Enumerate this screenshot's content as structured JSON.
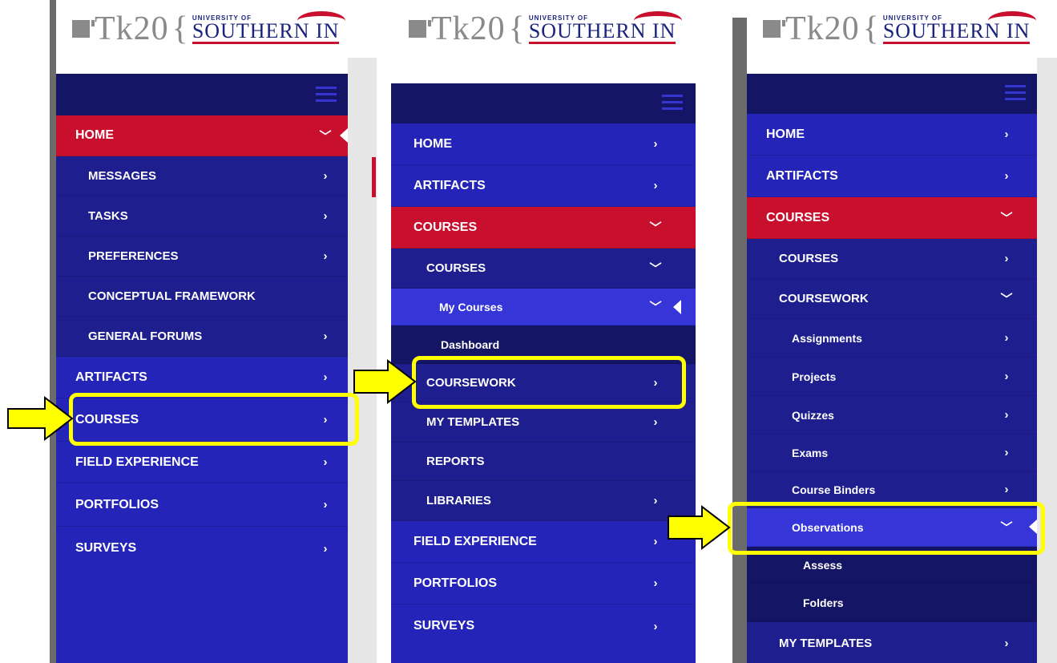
{
  "logo": {
    "tk": "Tk20",
    "brace": "{",
    "university_small": "UNIVERSITY OF",
    "university_big": "SOUTHERN IN"
  },
  "panel1": {
    "items": [
      {
        "label": "HOME",
        "chevron": "﹀"
      },
      {
        "label": "MESSAGES",
        "chevron": "›"
      },
      {
        "label": "TASKS",
        "chevron": "›"
      },
      {
        "label": "PREFERENCES",
        "chevron": "›"
      },
      {
        "label": "CONCEPTUAL FRAMEWORK",
        "chevron": ""
      },
      {
        "label": "GENERAL FORUMS",
        "chevron": "›"
      },
      {
        "label": "ARTIFACTS",
        "chevron": "›"
      },
      {
        "label": "COURSES",
        "chevron": "›"
      },
      {
        "label": "FIELD EXPERIENCE",
        "chevron": "›"
      },
      {
        "label": "PORTFOLIOS",
        "chevron": "›"
      },
      {
        "label": "SURVEYS",
        "chevron": "›"
      }
    ]
  },
  "panel2": {
    "items": [
      {
        "label": "HOME",
        "chevron": "›"
      },
      {
        "label": "ARTIFACTS",
        "chevron": "›"
      },
      {
        "label": "COURSES",
        "chevron": "﹀"
      },
      {
        "label": "COURSES",
        "chevron": "﹀"
      },
      {
        "label": "My Courses",
        "chevron": "﹀"
      },
      {
        "label": "Dashboard",
        "chevron": ""
      },
      {
        "label": "COURSEWORK",
        "chevron": "›"
      },
      {
        "label": "MY TEMPLATES",
        "chevron": "›"
      },
      {
        "label": "REPORTS",
        "chevron": ""
      },
      {
        "label": "LIBRARIES",
        "chevron": "›"
      },
      {
        "label": "FIELD EXPERIENCE",
        "chevron": "›"
      },
      {
        "label": "PORTFOLIOS",
        "chevron": "›"
      },
      {
        "label": "SURVEYS",
        "chevron": "›"
      }
    ]
  },
  "panel3": {
    "items": [
      {
        "label": "HOME",
        "chevron": "›"
      },
      {
        "label": "ARTIFACTS",
        "chevron": "›"
      },
      {
        "label": "COURSES",
        "chevron": "﹀"
      },
      {
        "label": "COURSES",
        "chevron": "›"
      },
      {
        "label": "COURSEWORK",
        "chevron": "﹀"
      },
      {
        "label": "Assignments",
        "chevron": "›"
      },
      {
        "label": "Projects",
        "chevron": "›"
      },
      {
        "label": "Quizzes",
        "chevron": "›"
      },
      {
        "label": "Exams",
        "chevron": "›"
      },
      {
        "label": "Course Binders",
        "chevron": "›"
      },
      {
        "label": "Observations",
        "chevron": "﹀"
      },
      {
        "label": "Assess",
        "chevron": ""
      },
      {
        "label": "Folders",
        "chevron": ""
      },
      {
        "label": "MY TEMPLATES",
        "chevron": "›"
      }
    ]
  },
  "colors": {
    "nav_blue": "#2424b8",
    "nav_dark": "#151565",
    "active_red": "#c8102e",
    "highlight": "#ffff00"
  }
}
